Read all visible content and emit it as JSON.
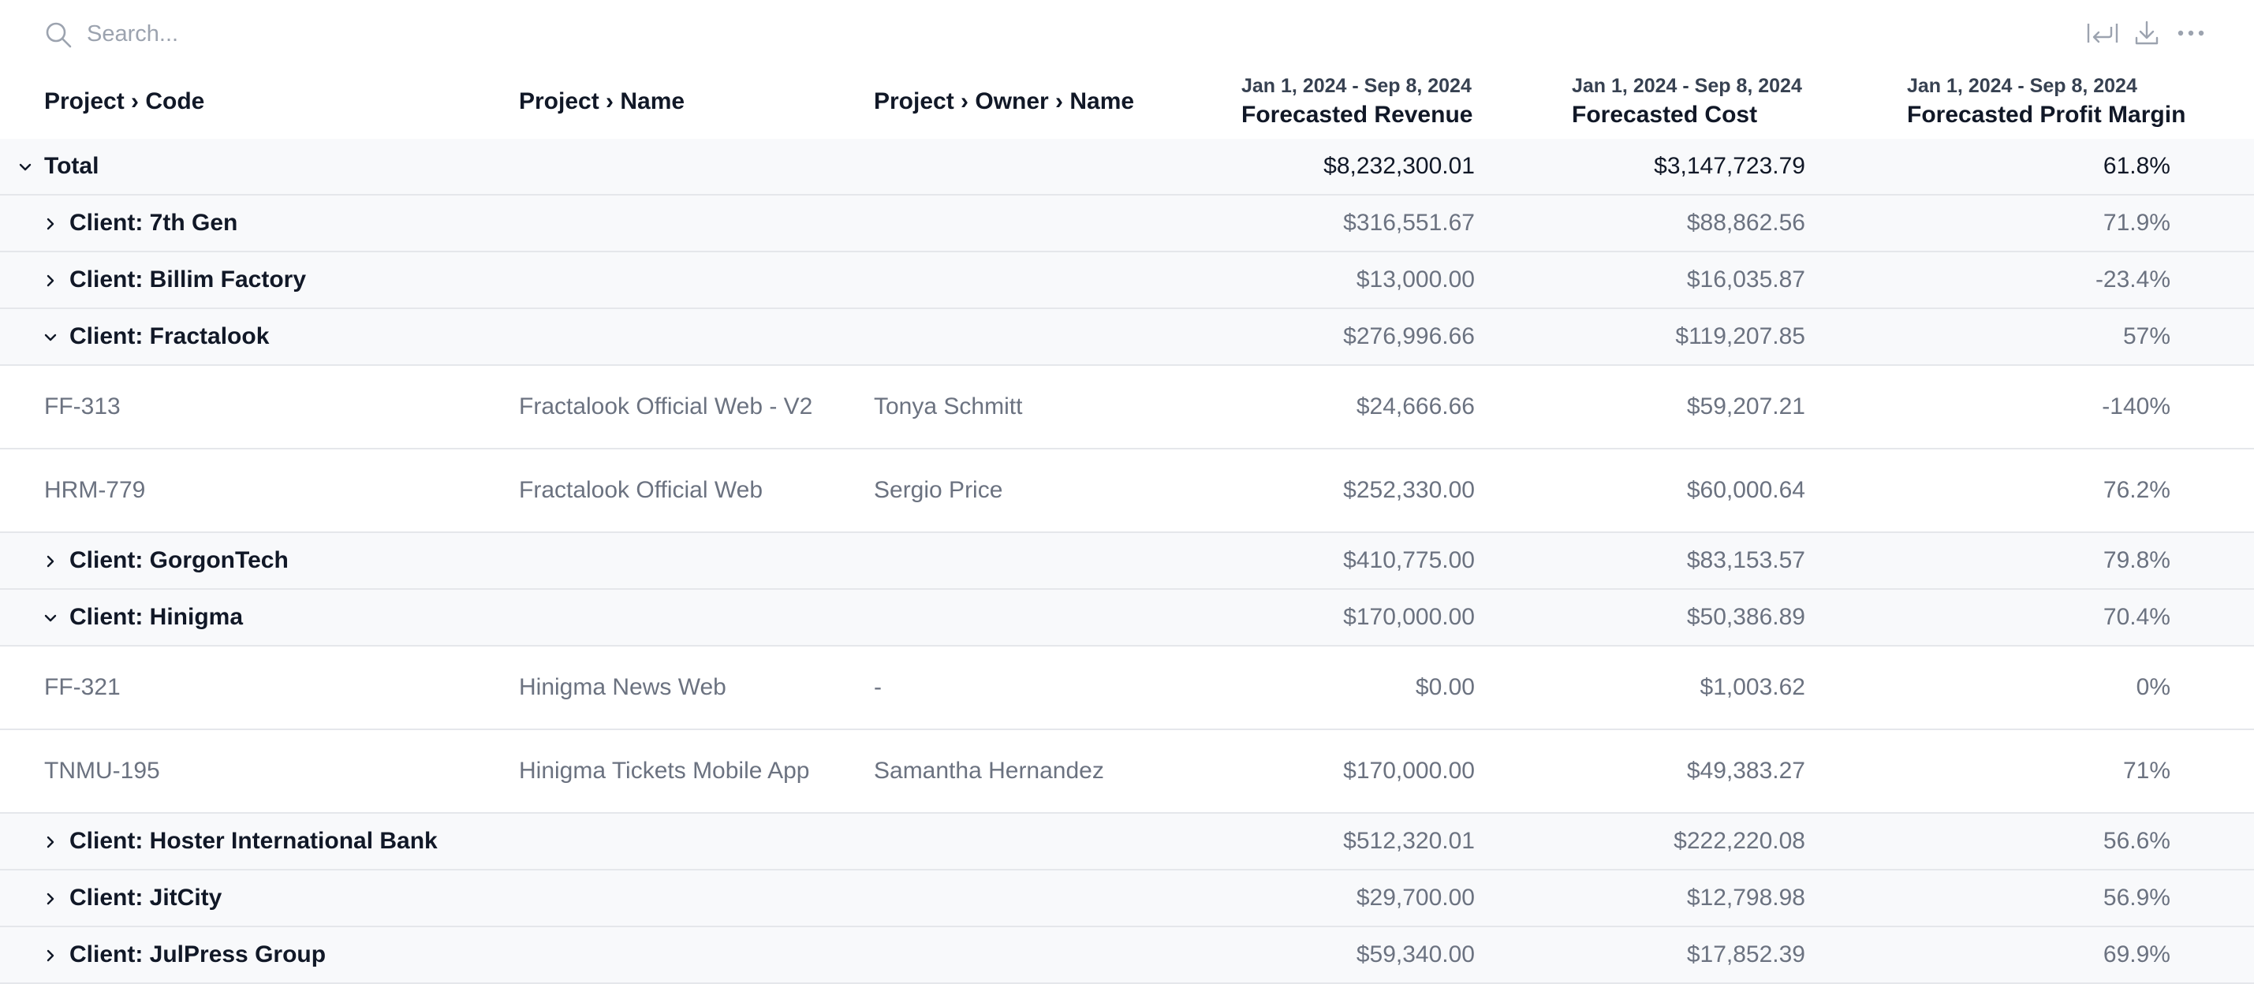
{
  "search": {
    "placeholder": "Search..."
  },
  "toolbar": {
    "icons": [
      "wrap-text-icon",
      "download-icon",
      "more-icon"
    ]
  },
  "columns": {
    "code": "Project › Code",
    "name": "Project › Name",
    "owner": "Project › Owner › Name",
    "revenue": {
      "range": "Jan 1, 2024 - Sep 8, 2024",
      "title": "Forecasted Revenue"
    },
    "cost": {
      "range": "Jan 1, 2024 - Sep 8, 2024",
      "title": "Forecasted Cost"
    },
    "margin": {
      "range": "Jan 1, 2024 - Sep 8, 2024",
      "title": "Forecasted Profit Margin"
    }
  },
  "rows": [
    {
      "type": "total",
      "expanded": true,
      "label": "Total",
      "revenue": "$8,232,300.01",
      "cost": "$3,147,723.79",
      "margin": "61.8%"
    },
    {
      "type": "group",
      "expanded": false,
      "label": "Client: 7th Gen",
      "revenue": "$316,551.67",
      "cost": "$88,862.56",
      "margin": "71.9%"
    },
    {
      "type": "group",
      "expanded": false,
      "label": "Client: Billim Factory",
      "revenue": "$13,000.00",
      "cost": "$16,035.87",
      "margin": "-23.4%"
    },
    {
      "type": "group",
      "expanded": true,
      "label": "Client: Fractalook",
      "revenue": "$276,996.66",
      "cost": "$119,207.85",
      "margin": "57%"
    },
    {
      "type": "detail",
      "code": "FF-313",
      "name": "Fractalook Official Web - V2",
      "owner": "Tonya Schmitt",
      "revenue": "$24,666.66",
      "cost": "$59,207.21",
      "margin": "-140%"
    },
    {
      "type": "detail",
      "code": "HRM-779",
      "name": "Fractalook Official Web",
      "owner": "Sergio Price",
      "revenue": "$252,330.00",
      "cost": "$60,000.64",
      "margin": "76.2%"
    },
    {
      "type": "group",
      "expanded": false,
      "label": "Client: GorgonTech",
      "revenue": "$410,775.00",
      "cost": "$83,153.57",
      "margin": "79.8%"
    },
    {
      "type": "group",
      "expanded": true,
      "label": "Client: Hinigma",
      "revenue": "$170,000.00",
      "cost": "$50,386.89",
      "margin": "70.4%"
    },
    {
      "type": "detail",
      "code": "FF-321",
      "name": "Hinigma News Web",
      "owner": "-",
      "revenue": "$0.00",
      "cost": "$1,003.62",
      "margin": "0%"
    },
    {
      "type": "detail",
      "code": "TNMU-195",
      "name": "Hinigma Tickets Mobile App",
      "owner": "Samantha Hernandez",
      "revenue": "$170,000.00",
      "cost": "$49,383.27",
      "margin": "71%"
    },
    {
      "type": "group",
      "expanded": false,
      "label": "Client: Hoster International Bank",
      "revenue": "$512,320.01",
      "cost": "$222,220.08",
      "margin": "56.6%"
    },
    {
      "type": "group",
      "expanded": false,
      "label": "Client: JitCity",
      "revenue": "$29,700.00",
      "cost": "$12,798.98",
      "margin": "56.9%"
    },
    {
      "type": "group",
      "expanded": false,
      "label": "Client: JulPress Group",
      "revenue": "$59,340.00",
      "cost": "$17,852.39",
      "margin": "69.9%"
    }
  ]
}
